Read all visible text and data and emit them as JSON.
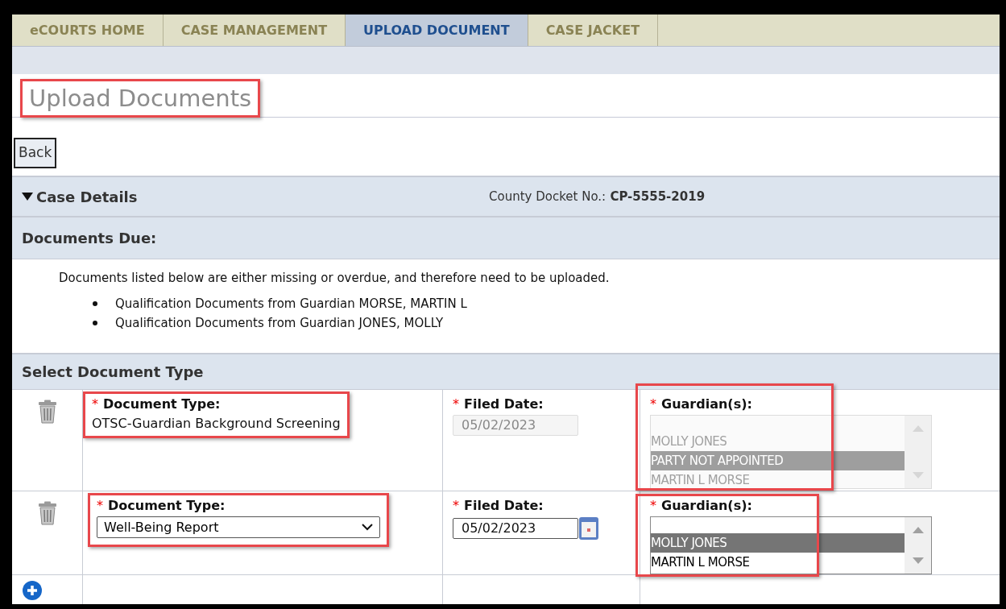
{
  "tabs": [
    {
      "label": "eCOURTS HOME",
      "selected": false
    },
    {
      "label": "CASE MANAGEMENT",
      "selected": false
    },
    {
      "label": "UPLOAD DOCUMENT",
      "selected": true
    },
    {
      "label": "CASE JACKET",
      "selected": false
    }
  ],
  "title": {
    "text": "Upload Documents",
    "highlighted": true
  },
  "back_button": "Back",
  "case_details": {
    "label": "Case Details",
    "expanded": true,
    "docket_label": "County Docket No.:",
    "docket_value": "CP-5555-2019"
  },
  "documents_due": {
    "heading": "Documents Due:",
    "intro": "Documents listed below are either missing or overdue, and therefore need to be uploaded.",
    "items": [
      "Qualification Documents from Guardian MORSE, MARTIN L",
      "Qualification Documents from Guardian JONES, MOLLY"
    ]
  },
  "select_document_type": {
    "heading": "Select Document Type",
    "rows": [
      {
        "document_type": {
          "required_marker": "*",
          "label": "Document Type:",
          "value": "OTSC-Guardian Background Screening",
          "kind": "text",
          "highlighted": true
        },
        "filed_date": {
          "required_marker": "*",
          "label": "Filed Date:",
          "value": "05/02/2023",
          "disabled": true
        },
        "guardians": {
          "required_marker": "*",
          "label": "Guardian(s):",
          "disabled": true,
          "highlighted": true,
          "options": [
            {
              "label": "MOLLY JONES",
              "selected": false
            },
            {
              "label": "PARTY NOT APPOINTED",
              "selected": true
            },
            {
              "label": "MARTIN L MORSE",
              "selected": false
            }
          ]
        }
      },
      {
        "document_type": {
          "required_marker": "*",
          "label": "Document Type:",
          "value": "Well-Being Report",
          "kind": "dropdown",
          "highlighted": true
        },
        "filed_date": {
          "required_marker": "*",
          "label": "Filed Date:",
          "value": "05/02/2023",
          "disabled": false
        },
        "guardians": {
          "required_marker": "*",
          "label": "Guardian(s):",
          "disabled": false,
          "highlighted": true,
          "options": [
            {
              "label": "MOLLY JONES",
              "selected": true
            },
            {
              "label": "MARTIN L MORSE",
              "selected": false
            }
          ]
        }
      }
    ]
  }
}
